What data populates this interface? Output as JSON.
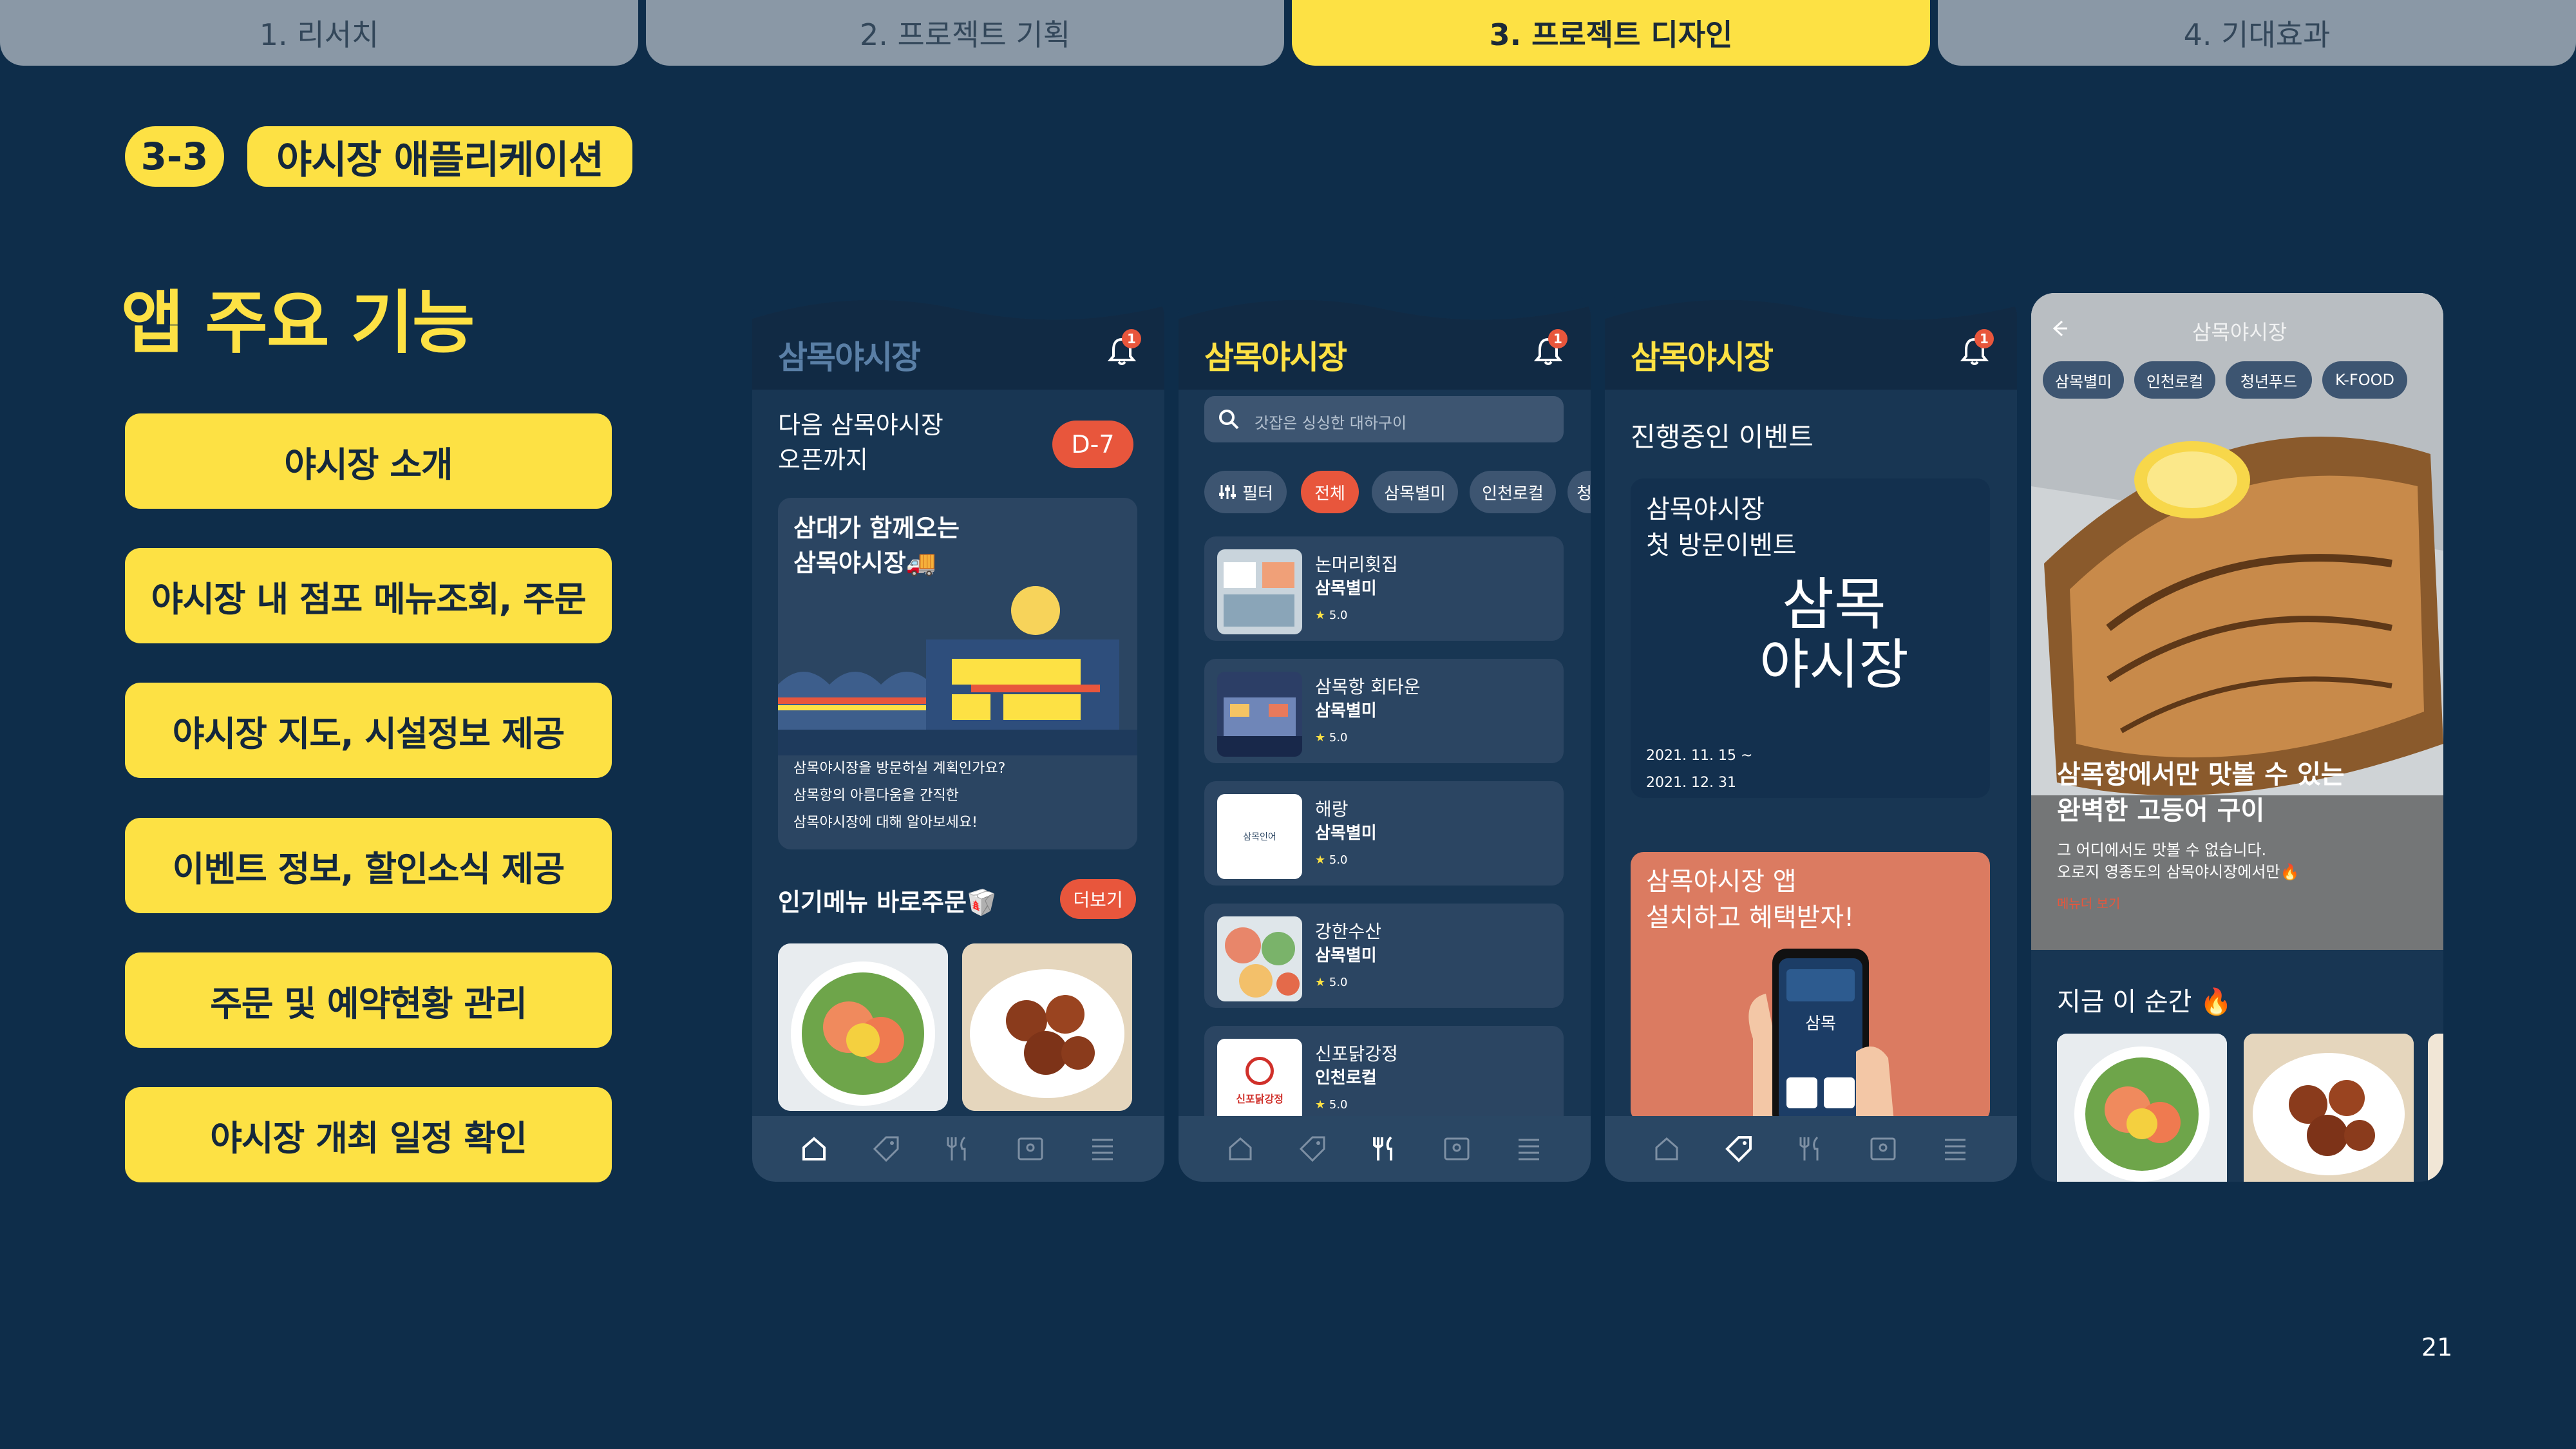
{
  "tabs": [
    "1. 리서치",
    "2. 프로젝트 기획",
    "3. 프로젝트 디자인",
    "4. 기대효과"
  ],
  "section": {
    "number": "3-3",
    "title": "야시장 애플리케이션"
  },
  "heading": "앱 주요 기능",
  "features": [
    "야시장 소개",
    "야시장 내 점포 메뉴조회, 주문",
    "야시장 지도, 시설정보 제공",
    "이벤트 정보, 할인소식 제공",
    "주문 및 예약현황 관리",
    "야시장 개최 일정 확인"
  ],
  "page_number": "21",
  "colors": {
    "background": "#0e2d4a",
    "accent": "#fde144",
    "phone": "#183653",
    "badge": "#e8563c"
  },
  "phone1": {
    "logo": "삼목야시장",
    "notification_count": "1",
    "countdown_line1": "다음 삼목야시장",
    "countdown_line2": "오픈까지",
    "d_day": "D-7",
    "banner_title1": "삼대가 함께오는",
    "banner_title2": "삼목야시장🚚",
    "banner_desc1": "삼목야시장을 방문하실 계획인가요?",
    "banner_desc2": "삼목항의 아름다움을 간직한",
    "banner_desc3": "삼목야시장에 대해 알아보세요!",
    "popular_title": "인기메뉴 바로주문🥡",
    "more_label": "더보기",
    "nav_icons": [
      "home-icon",
      "tag-icon",
      "fork-knife-icon",
      "map-icon",
      "list-icon"
    ]
  },
  "phone2": {
    "logo": "삼목야시장",
    "notification_count": "1",
    "search_placeholder": "갓잡은 싱싱한 대하구이",
    "filter_label": "필터",
    "chips": [
      "전체",
      "삼목별미",
      "인천로컬",
      "청"
    ],
    "stores": [
      {
        "name": "논머리횟집",
        "tag": "삼목별미",
        "rating": "5.0"
      },
      {
        "name": "삼목항 회타운",
        "tag": "삼목별미",
        "rating": "5.0"
      },
      {
        "name": "해랑",
        "tag": "삼목별미",
        "rating": "5.0",
        "logo_text": "삼목인어"
      },
      {
        "name": "강한수산",
        "tag": "삼목별미",
        "rating": "5.0"
      },
      {
        "name": "신포닭강정",
        "tag": "인천로컬",
        "rating": "5.0",
        "logo_text": "신포닭강정"
      }
    ]
  },
  "phone3": {
    "logo": "삼목야시장",
    "notification_count": "1",
    "section_title": "진행중인 이벤트",
    "event_title1": "삼목야시장",
    "event_title2": "첫 방문이벤트",
    "event_logo1": "삼목",
    "event_logo2": "야시장",
    "event_date1": "2021. 11. 15 ~",
    "event_date2": "2021. 12. 31",
    "promo_title1": "삼목야시장 앱",
    "promo_title2": "설치하고 혜택받자!"
  },
  "phone4": {
    "logo": "삼목야시장",
    "chips": [
      "삼목별미",
      "인천로컬",
      "청년푸드",
      "K-FOOD"
    ],
    "hero_title1": "삼목항에서만 맛볼 수 있는",
    "hero_title2": "완벽한 고등어 구이",
    "hero_desc1": "그 어디에서도 맛볼 수 없습니다.",
    "hero_desc2": "오로지 영종도의 삼목야시장에서만🔥",
    "hero_link": "메뉴더 보기",
    "moment_title": "지금 이 순간 🔥"
  }
}
